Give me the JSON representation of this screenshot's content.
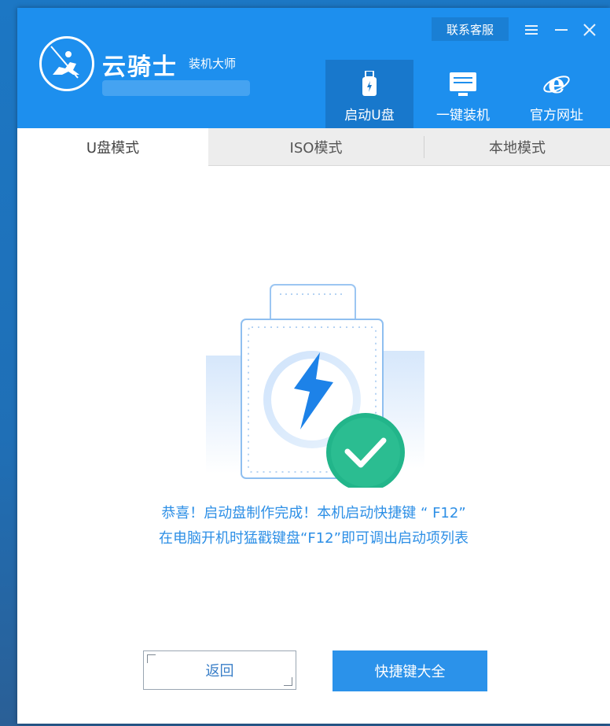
{
  "app": {
    "name": "云骑士",
    "subtitle": "装机大师"
  },
  "header": {
    "contact_label": "联系客服",
    "nav": [
      {
        "label": "启动U盘",
        "icon": "usb-drive-icon",
        "active": true
      },
      {
        "label": "一键装机",
        "icon": "computer-icon",
        "active": false
      },
      {
        "label": "官方网址",
        "icon": "ie-browser-icon",
        "active": false
      }
    ]
  },
  "tabs": [
    {
      "label": "U盘模式",
      "active": true
    },
    {
      "label": "ISO模式",
      "active": false
    },
    {
      "label": "本地模式",
      "active": false
    }
  ],
  "result": {
    "line1": "恭喜！启动盘制作完成！本机启动快捷键 “ F12”",
    "line2": "在电脑开机时猛戳键盘“F12”即可调出启动项列表"
  },
  "buttons": {
    "back_label": "返回",
    "hotkeys_label": "快捷键大全"
  },
  "colors": {
    "header_blue": "#1d8fee",
    "active_nav": "#1878cc",
    "text_blue": "#2d8fe6",
    "success_green": "#22b58a",
    "primary_button": "#2b92ea"
  }
}
